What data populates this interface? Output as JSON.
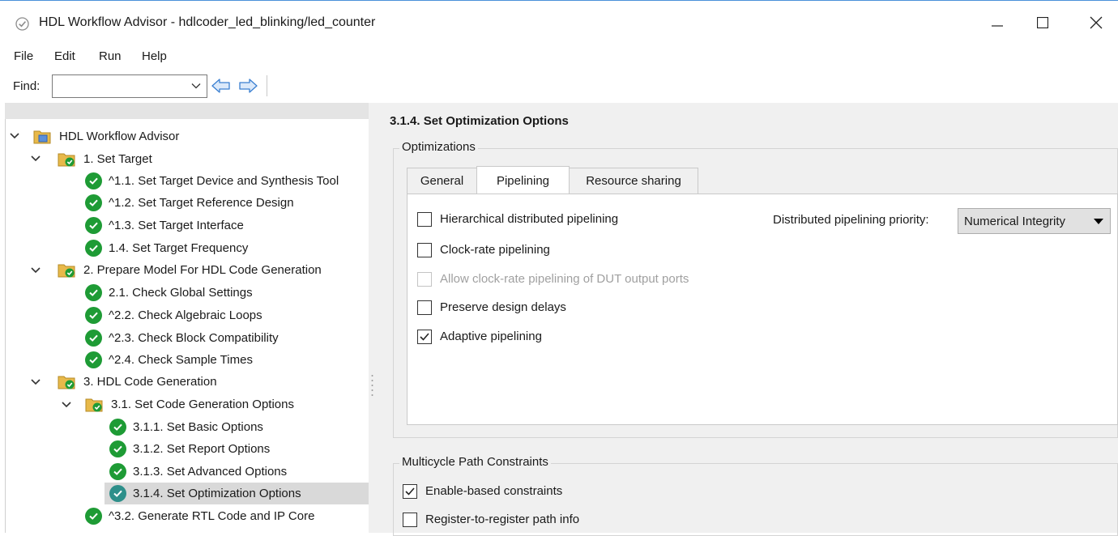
{
  "window": {
    "title": "HDL Workflow Advisor - hdlcoder_led_blinking/led_counter",
    "controls": [
      "minimize-icon",
      "maximize-icon",
      "close-icon"
    ]
  },
  "menu": {
    "items": [
      "File",
      "Edit",
      "Run",
      "Help"
    ]
  },
  "toolbar": {
    "find_label": "Find:",
    "find_value": "",
    "icons": [
      "back-arrow-icon",
      "forward-arrow-icon"
    ]
  },
  "tree": {
    "root": "HDL Workflow Advisor",
    "items": [
      {
        "label": "1. Set Target",
        "type": "folder"
      },
      {
        "label": "^1.1. Set Target Device and Synthesis Tool",
        "type": "task"
      },
      {
        "label": "^1.2. Set Target Reference Design",
        "type": "task"
      },
      {
        "label": "^1.3. Set Target Interface",
        "type": "task"
      },
      {
        "label": "1.4. Set Target Frequency",
        "type": "task"
      },
      {
        "label": "2. Prepare Model For HDL Code Generation",
        "type": "folder"
      },
      {
        "label": "2.1. Check Global Settings",
        "type": "task"
      },
      {
        "label": "^2.2. Check Algebraic Loops",
        "type": "task"
      },
      {
        "label": "^2.3. Check Block Compatibility",
        "type": "task"
      },
      {
        "label": "^2.4. Check Sample Times",
        "type": "task"
      },
      {
        "label": "3. HDL Code Generation",
        "type": "folder"
      },
      {
        "label": "3.1. Set Code Generation Options",
        "type": "folder"
      },
      {
        "label": "3.1.1. Set Basic Options",
        "type": "task"
      },
      {
        "label": "3.1.2. Set Report Options",
        "type": "task"
      },
      {
        "label": "3.1.3. Set Advanced Options",
        "type": "task"
      },
      {
        "label": "3.1.4. Set Optimization Options",
        "type": "task",
        "selected": true
      },
      {
        "label": "^3.2. Generate RTL Code and IP Core",
        "type": "task"
      }
    ]
  },
  "main": {
    "title": "3.1.4. Set Optimization Options",
    "optimizations": {
      "group_label": "Optimizations",
      "tabs": [
        "General",
        "Pipelining",
        "Resource sharing"
      ],
      "active_tab": "Pipelining",
      "pipelining": {
        "checkboxes": [
          {
            "label": "Hierarchical distributed pipelining",
            "checked": false,
            "enabled": true
          },
          {
            "label": "Clock-rate pipelining",
            "checked": false,
            "enabled": true
          },
          {
            "label": "Allow clock-rate pipelining of DUT output ports",
            "checked": false,
            "enabled": false
          },
          {
            "label": "Preserve design delays",
            "checked": false,
            "enabled": true
          },
          {
            "label": "Adaptive pipelining",
            "checked": true,
            "enabled": true
          }
        ],
        "priority_label": "Distributed pipelining priority:",
        "priority_value": "Numerical Integrity"
      }
    },
    "multicycle": {
      "group_label": "Multicycle Path Constraints",
      "checkboxes": [
        {
          "label": "Enable-based constraints",
          "checked": true
        },
        {
          "label": "Register-to-register path info",
          "checked": false
        }
      ]
    }
  },
  "colors": {
    "check_green": "#1e9b35",
    "selected_row": "#d9d9d9",
    "pane_bg": "#f0f0f0",
    "nav_arrow": "#3a7fd1"
  }
}
